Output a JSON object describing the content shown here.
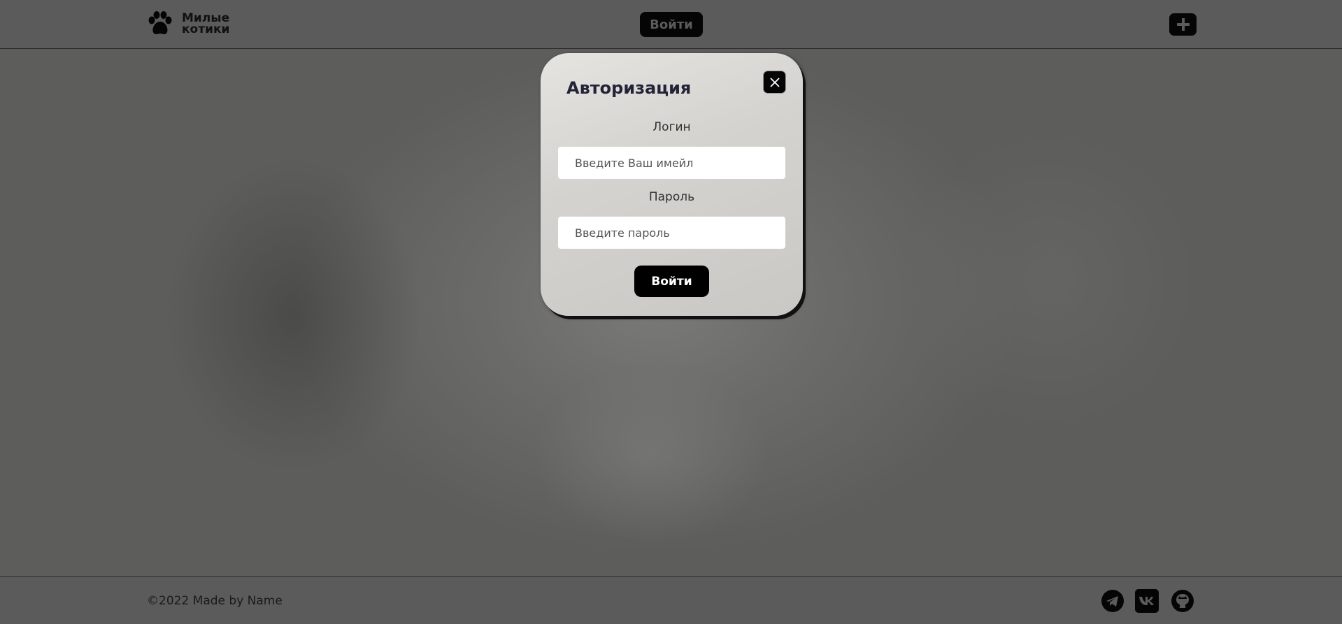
{
  "header": {
    "logo_line1": "Милые",
    "logo_line2": "котики",
    "login_label": "Войти"
  },
  "modal": {
    "title": "Авторизация",
    "login_label": "Логин",
    "login_placeholder": "Введите Ваш имейл",
    "password_label": "Пароль",
    "password_placeholder": "Введите пароль",
    "submit_label": "Войти"
  },
  "footer": {
    "copyright": "©2022 Made by Name",
    "social": [
      "telegram-icon",
      "vk-icon",
      "github-icon"
    ]
  },
  "colors": {
    "overlay": "#5b5b5b",
    "button": "#050505",
    "title": "#232338"
  }
}
